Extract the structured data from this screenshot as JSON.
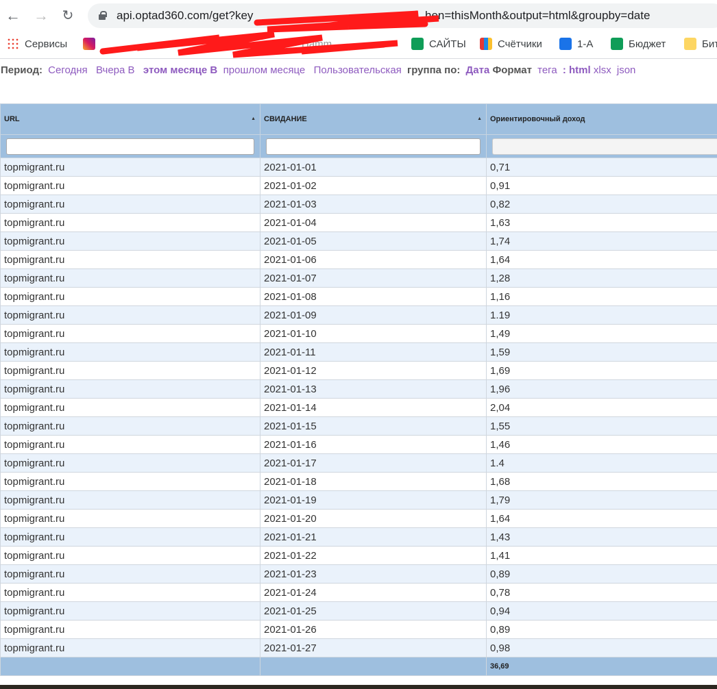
{
  "browser": {
    "url_visible_start": "api.optad360.com/get?key",
    "url_visible_end": "hen=thisMonth&output=html&groupby=date",
    "bookmarks": [
      {
        "label": "Сервисы",
        "icon": "apps-grid-icon"
      },
      {
        "label": "",
        "icon": "instagram-icon"
      },
      {
        "label": "Hamm",
        "icon": "hammer-icon"
      },
      {
        "label": "САЙТЫ",
        "icon": "google-sheets-icon"
      },
      {
        "label": "Счётчики",
        "icon": "analytics-icon"
      },
      {
        "label": "1-А",
        "icon": "contact-icon"
      },
      {
        "label": "Бюджет",
        "icon": "google-sheets-icon"
      },
      {
        "label": "Бит",
        "icon": "folder-icon"
      }
    ]
  },
  "filters": {
    "period_label": "Период:",
    "periods": [
      "Сегодня",
      "Вчера В",
      "этом месяце В",
      "прошлом месяце",
      "Пользовательская"
    ],
    "group_label": "группа по:",
    "group_value": "Дата",
    "format_label": "Формат",
    "format_tag": "тега",
    "colon": ":",
    "formats": [
      "html",
      "xlsx",
      "json"
    ]
  },
  "table": {
    "columns": [
      "URL",
      "СВИДАНИЕ",
      "Ориентировочный доход"
    ],
    "rows": [
      [
        "topmigrant.ru",
        "2021-01-01",
        "0,71"
      ],
      [
        "topmigrant.ru",
        "2021-01-02",
        "0,91"
      ],
      [
        "topmigrant.ru",
        "2021-01-03",
        "0,82"
      ],
      [
        "topmigrant.ru",
        "2021-01-04",
        "1,63"
      ],
      [
        "topmigrant.ru",
        "2021-01-05",
        "1,74"
      ],
      [
        "topmigrant.ru",
        "2021-01-06",
        "1,64"
      ],
      [
        "topmigrant.ru",
        "2021-01-07",
        "1,28"
      ],
      [
        "topmigrant.ru",
        "2021-01-08",
        "1,16"
      ],
      [
        "topmigrant.ru",
        "2021-01-09",
        "1.19"
      ],
      [
        "topmigrant.ru",
        "2021-01-10",
        "1,49"
      ],
      [
        "topmigrant.ru",
        "2021-01-11",
        "1,59"
      ],
      [
        "topmigrant.ru",
        "2021-01-12",
        "1,69"
      ],
      [
        "topmigrant.ru",
        "2021-01-13",
        "1,96"
      ],
      [
        "topmigrant.ru",
        "2021-01-14",
        "2,04"
      ],
      [
        "topmigrant.ru",
        "2021-01-15",
        "1,55"
      ],
      [
        "topmigrant.ru",
        "2021-01-16",
        "1,46"
      ],
      [
        "topmigrant.ru",
        "2021-01-17",
        "1.4"
      ],
      [
        "topmigrant.ru",
        "2021-01-18",
        "1,68"
      ],
      [
        "topmigrant.ru",
        "2021-01-19",
        "1,79"
      ],
      [
        "topmigrant.ru",
        "2021-01-20",
        "1,64"
      ],
      [
        "topmigrant.ru",
        "2021-01-21",
        "1,43"
      ],
      [
        "topmigrant.ru",
        "2021-01-22",
        "1,41"
      ],
      [
        "topmigrant.ru",
        "2021-01-23",
        "0,89"
      ],
      [
        "topmigrant.ru",
        "2021-01-24",
        "0,78"
      ],
      [
        "topmigrant.ru",
        "2021-01-25",
        "0,94"
      ],
      [
        "topmigrant.ru",
        "2021-01-26",
        "0,89"
      ],
      [
        "topmigrant.ru",
        "2021-01-27",
        "0,98"
      ]
    ],
    "total": "36,69"
  },
  "colors": {
    "header": "#9ebfdf",
    "row_alt": "#eaf2fb",
    "link": "#8e5bbf"
  }
}
